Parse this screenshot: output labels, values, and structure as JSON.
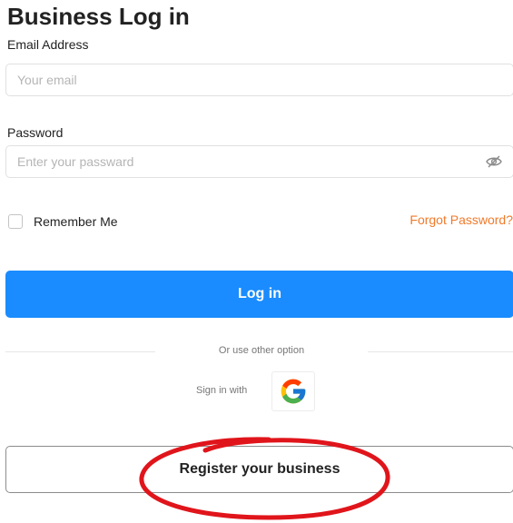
{
  "title": "Business Log in",
  "email": {
    "label": "Email Address",
    "placeholder": "Your email",
    "value": ""
  },
  "password": {
    "label": "Password",
    "placeholder": "Enter your passward",
    "value": "",
    "visibility_icon": "eye-slash-icon"
  },
  "remember": {
    "label": "Remember Me",
    "checked": false
  },
  "forgot_label": "Forgot Password?",
  "login_label": "Log in",
  "divider_text": "Or use other option",
  "social": {
    "sign_in_label": "Sign in with",
    "provider_icon": "google-icon"
  },
  "register_label": "Register your business",
  "colors": {
    "primary": "#1a8cff",
    "link": "#f07a2a",
    "annotation": "#e0151b"
  }
}
